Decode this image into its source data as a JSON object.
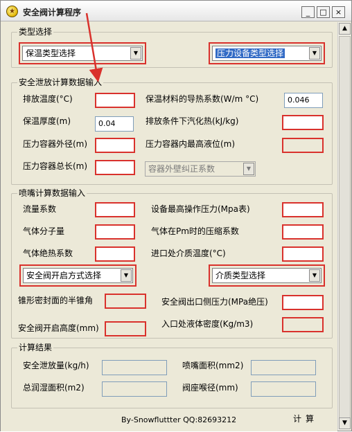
{
  "window": {
    "title": "安全阀计算程序",
    "minimize": "_",
    "maximize": "□",
    "close": "×"
  },
  "type_section": {
    "legend": "类型选择",
    "insulation_select": "保温类型选择",
    "pressure_select": "压力设备类型选择"
  },
  "relief_section": {
    "legend": "安全泄放计算数据输入",
    "discharge_temp_label": "排放温度(°C)",
    "discharge_temp_value": "",
    "thermal_conductivity_label": "保温材料的导热系数(W/m °C)",
    "thermal_conductivity_value": "0.046",
    "insulation_thickness_label": "保温厚度(m)",
    "insulation_thickness_value": "0.04",
    "vaporization_heat_label": "排放条件下汽化热(kJ/kg)",
    "vaporization_heat_value": "",
    "vessel_od_label": "压力容器外径(m)",
    "vessel_od_value": "",
    "max_level_label": "压力容器内最高液位(m)",
    "max_level_value": "",
    "vessel_length_label": "压力容器总长(m)",
    "vessel_length_value": "",
    "wall_correction_select": "容器外壁纠正系数"
  },
  "nozzle_section": {
    "legend": "喷嘴计算数据输入",
    "flow_coef_label": "流量系数",
    "flow_coef_value": "",
    "max_op_pressure_label": "设备最高操作压力(Mpa表)",
    "max_op_pressure_value": "",
    "molecular_weight_label": "气体分子量",
    "molecular_weight_value": "",
    "compress_factor_label": "气体在Pm时的压缩系数",
    "compress_factor_value": "",
    "adiabatic_label": "气体绝热系数",
    "adiabatic_value": "",
    "inlet_temp_label": "进口处介质温度(°C)",
    "inlet_temp_value": "",
    "open_mode_select": "安全阀开启方式选择",
    "medium_select": "介质类型选择",
    "cone_angle_label": "锥形密封面的半锥角",
    "cone_angle_value": "",
    "outlet_pressure_label": "安全阀出口侧压力(MPa绝压)",
    "outlet_pressure_value": "",
    "open_height_label": "安全阀开启高度(mm)",
    "open_height_value": "",
    "liquid_density_label": "入口处液体密度(Kg/m3)",
    "liquid_density_value": ""
  },
  "results_section": {
    "legend": "计算结果",
    "relief_amount_label": "安全泄放量(kg/h)",
    "relief_amount_value": "",
    "nozzle_area_label": "喷嘴面积(mm2)",
    "nozzle_area_value": "",
    "wetted_area_label": "总润湿面积(m2)",
    "wetted_area_value": "",
    "seat_throat_label": "阀座喉径(mm)",
    "seat_throat_value": ""
  },
  "footer": {
    "credit": "By-Snowfluttter  QQ:82693212",
    "calculate": "计算"
  },
  "colors": {
    "highlight_border": "#d9312c",
    "selection": "#316ac5",
    "window_bg": "#ece9d8"
  }
}
